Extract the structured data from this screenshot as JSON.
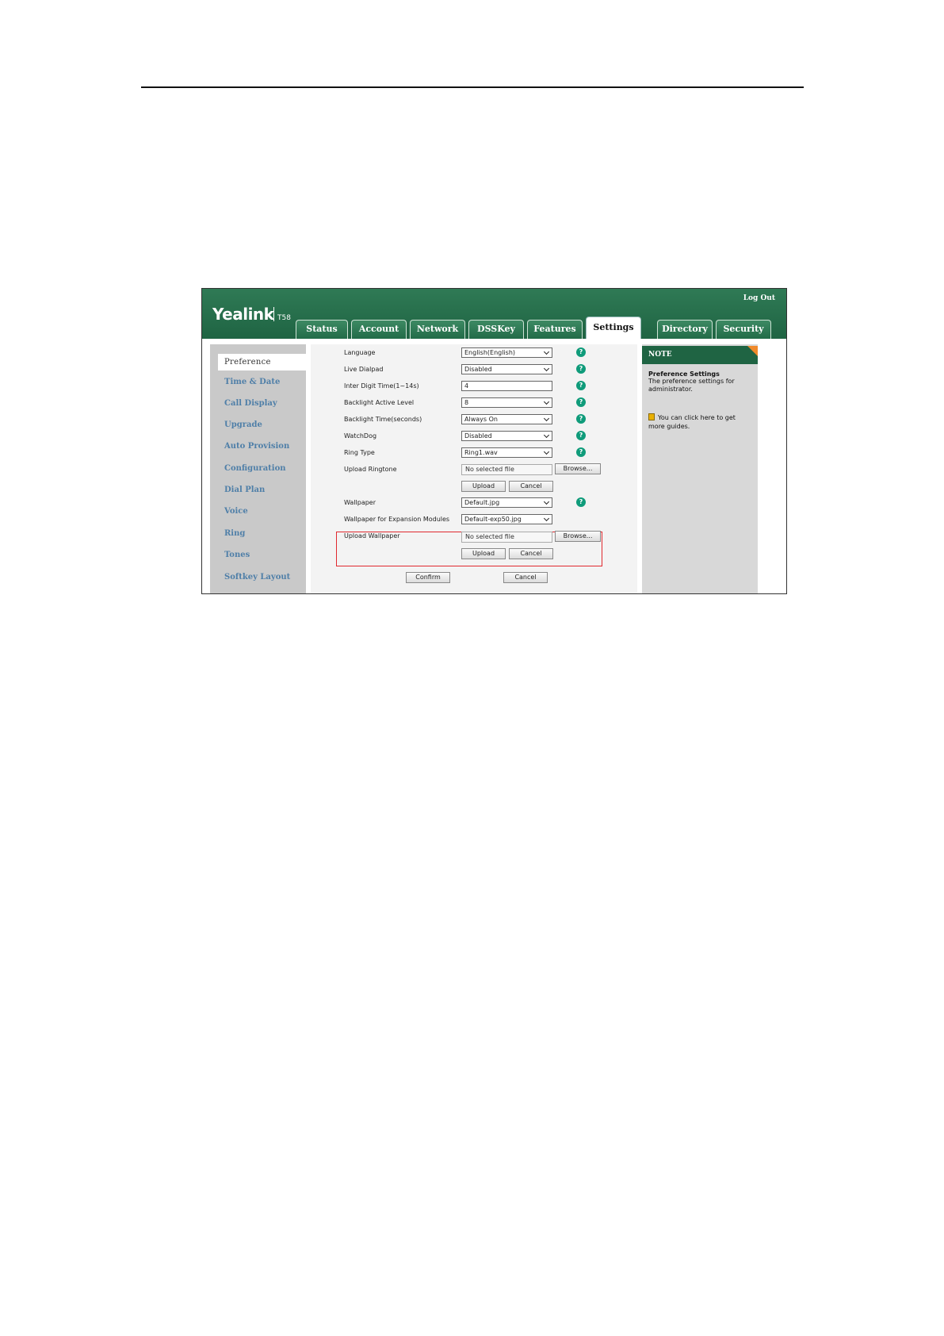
{
  "header": {
    "logo": "Yealink",
    "model": "T58",
    "logout": "Log Out",
    "tabs": [
      {
        "label": "Status"
      },
      {
        "label": "Account"
      },
      {
        "label": "Network"
      },
      {
        "label": "DSSKey"
      },
      {
        "label": "Features"
      },
      {
        "label": "Settings"
      },
      {
        "label": "Directory"
      },
      {
        "label": "Security"
      }
    ],
    "active_tab": "Settings"
  },
  "sidebar": {
    "items": [
      {
        "label": "Preference"
      },
      {
        "label": "Time & Date"
      },
      {
        "label": "Call Display"
      },
      {
        "label": "Upgrade"
      },
      {
        "label": "Auto Provision"
      },
      {
        "label": "Configuration"
      },
      {
        "label": "Dial Plan"
      },
      {
        "label": "Voice"
      },
      {
        "label": "Ring"
      },
      {
        "label": "Tones"
      },
      {
        "label": "Softkey Layout"
      }
    ],
    "active_item": "Preference"
  },
  "form": {
    "language": {
      "label": "Language",
      "value": "English(English)"
    },
    "live_dialpad": {
      "label": "Live Dialpad",
      "value": "Disabled"
    },
    "inter_digit": {
      "label": "Inter Digit Time(1~14s)",
      "value": "4"
    },
    "backlight_level": {
      "label": "Backlight Active Level",
      "value": "8"
    },
    "backlight_time": {
      "label": "Backlight Time(seconds)",
      "value": "Always On"
    },
    "watchdog": {
      "label": "WatchDog",
      "value": "Disabled"
    },
    "ring_type": {
      "label": "Ring Type",
      "value": "Ring1.wav"
    },
    "upload_ringtone": {
      "label": "Upload Ringtone",
      "file": "No selected file",
      "browse": "Browse...",
      "upload": "Upload",
      "cancel": "Cancel"
    },
    "wallpaper": {
      "label": "Wallpaper",
      "value": "Default.jpg"
    },
    "wallpaper_exp": {
      "label": "Wallpaper for Expansion Modules",
      "value": "Default-exp50.jpg"
    },
    "upload_wallpaper": {
      "label": "Upload Wallpaper",
      "file": "No selected file",
      "browse": "Browse...",
      "upload": "Upload",
      "cancel": "Cancel"
    },
    "confirm": "Confirm",
    "cancel": "Cancel",
    "help_glyph": "?"
  },
  "note": {
    "heading": "NOTE",
    "title": "Preference Settings",
    "text": "The preference settings for administrator.",
    "link": "You can click here to get more guides."
  },
  "colors": {
    "header_green": "#1f6443",
    "highlight_red": "#e0282e",
    "help_teal": "#0f9b7a",
    "sidebar_link": "#4f7fa8"
  }
}
